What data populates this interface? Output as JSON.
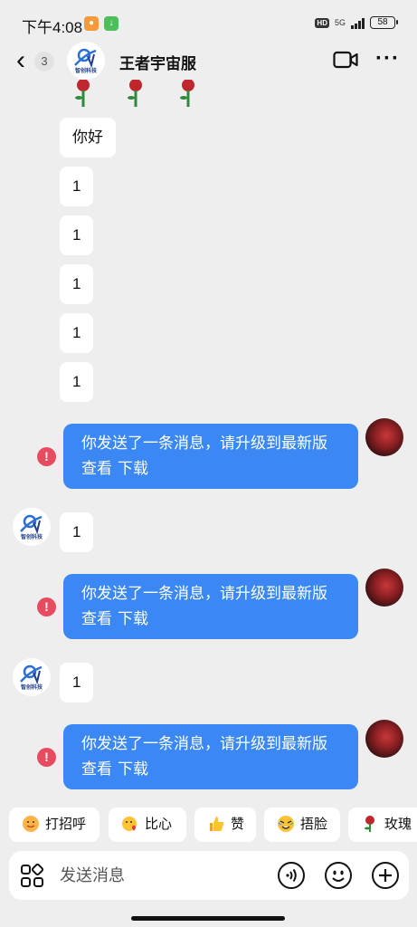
{
  "status_bar": {
    "time": "下午4:08",
    "hd": "HD",
    "network": "5G",
    "battery": "58"
  },
  "header": {
    "back_count": "3",
    "title": "王者宇宙服",
    "avatar_brand": "智创科技"
  },
  "messages": {
    "hello": "你好",
    "ones": [
      "1",
      "1",
      "1",
      "1",
      "1"
    ],
    "outgoing_text": "你发送了一条消息，请升级到最新版查看",
    "outgoing_link": "下载",
    "reply_one": "1",
    "reply_two": "1",
    "error_mark": "!"
  },
  "quick_replies": [
    "打招呼",
    "比心",
    "赞",
    "捂脸",
    "玫瑰"
  ],
  "input": {
    "placeholder": "发送消息"
  },
  "colors": {
    "background": "#eeeeee",
    "outgoing_bubble": "#3b88f5",
    "error": "#e84a5f"
  },
  "icons": [
    "back-arrow-icon",
    "video-call-icon",
    "more-icon",
    "grid-apps-icon",
    "voice-icon",
    "emoji-icon",
    "plus-icon",
    "rose-icon",
    "error-icon"
  ]
}
